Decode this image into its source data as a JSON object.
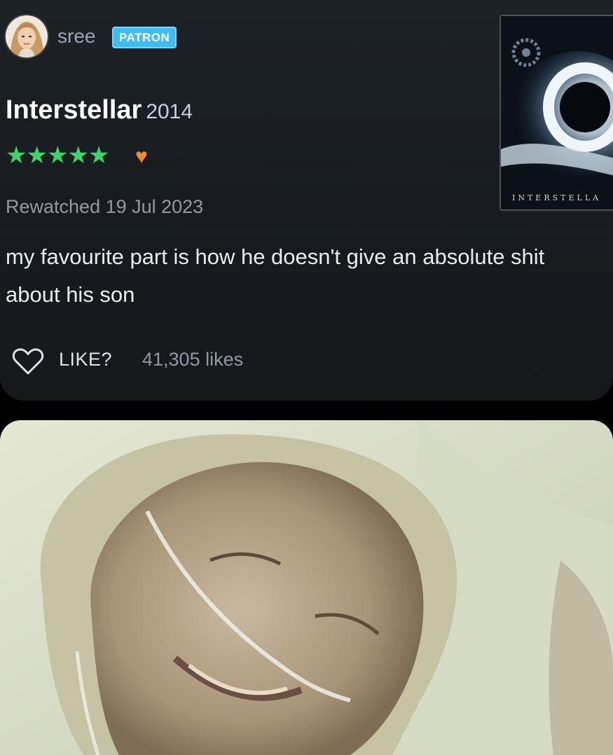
{
  "review": {
    "username": "sree",
    "badge": "PATRON",
    "film_title": "Interstellar",
    "film_year": "2014",
    "rating_stars": "★★★★★",
    "rating": 5,
    "liked": true,
    "heart_symbol": "♥",
    "watch_note": "Rewatched 19 Jul 2023",
    "text": "my favourite part is how he doesn't give an absolute shit about his son",
    "like_label": "LIKE?",
    "likes_count": "41,305 likes",
    "poster_title": "INTERSTELLA"
  },
  "colors": {
    "card_bg": "#1b2024",
    "star_green": "#40d36b",
    "heart_orange": "#ee8c32",
    "patron_blue": "#40bcf4",
    "muted_text": "#8f9aa4"
  },
  "icons": {
    "like": "heart-outline-icon",
    "liked": "heart-filled-icon"
  }
}
